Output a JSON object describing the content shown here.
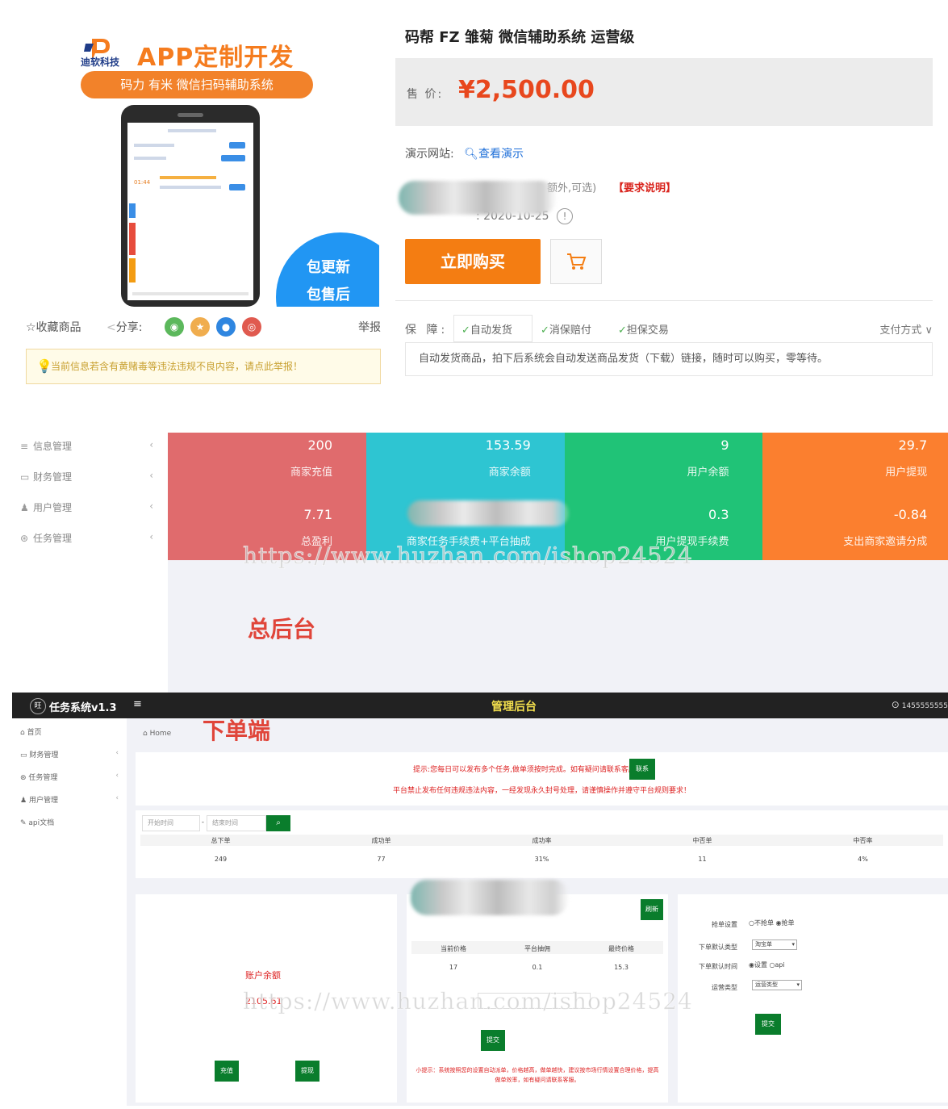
{
  "product": {
    "brand_name": "迪软科技",
    "banner_title": "APP定制开发",
    "banner_sub": "码力 有米 微信扫码辅助系统",
    "badge_line1": "包更新",
    "badge_line2": "包售后",
    "fav_label": "☆收藏商品",
    "share_label": "分享:",
    "report_label": "举报",
    "notice": "当前信息若含有黄赌毒等违法违规不良内容，请点此举报！",
    "title": "码帮 FZ 雏菊 微信辅助系统 运营级",
    "price_label": "售 价:",
    "price": "¥2,500.00",
    "demo_label": "演示网站:",
    "demo_link": "查看演示",
    "opt_note": "额外,可选)",
    "opt_req": "【要求说明】",
    "date_partial": ": 2020-10-25",
    "buy_label": "立即购买",
    "guarantee_label": "保 障:",
    "guarantees": [
      "自动发货",
      "消保赔付",
      "担保交易"
    ],
    "pay_method": "支付方式",
    "description": "自动发货商品，拍下后系统会自动发送商品发货（下载）链接，随时可以购买，零等待。",
    "phone_time": "01:44"
  },
  "admin": {
    "sidebar": [
      "信息管理",
      "财务管理",
      "用户管理",
      "任务管理"
    ],
    "stats": [
      {
        "v1": "200",
        "l1": "商家充值",
        "v2": "7.71",
        "l2": "总盈利",
        "color": "#e06b6d"
      },
      {
        "v1": "153.59",
        "l1": "商家余额",
        "v2": "",
        "l2": "商家任务手续费+平台抽成",
        "color": "#2ec5d2"
      },
      {
        "v1": "9",
        "l1": "用户余额",
        "v2": "0.3",
        "l2": "用户提现手续费",
        "color": "#20c377"
      },
      {
        "v1": "29.7",
        "l1": "用户提现",
        "v2": "-0.84",
        "l2": "支出商家邀请分成",
        "color": "#fb7f2f"
      }
    ],
    "label": "总后台",
    "watermark": "https://www.huzhan.com/ishop24524"
  },
  "client": {
    "app_name": "任务系统v1.3",
    "menu_icon": "≡",
    "center_title": "管理后台",
    "user": "1455555555",
    "label": "下单端",
    "sidebar": [
      "首页",
      "财务管理",
      "任务管理",
      "用户管理",
      "api文档"
    ],
    "breadcrumb": "Home",
    "notice_line1": "提示:您每日可以发布多个任务,做单须按时完成。如有疑问请联系客服:",
    "notice_btn": "联系",
    "notice_line2": "平台禁止发布任何违规违法内容，一经发现永久封号处理，请谨慎操作并遵守平台规则要求！",
    "date_start": "开始时间",
    "date_end": "结束时间",
    "search_icon": "search-icon",
    "stats_headers": [
      "总下单",
      "成功单",
      "成功率",
      "中否单",
      "中否率"
    ],
    "stats_values": [
      "249",
      "77",
      "31%",
      "11",
      "4%"
    ],
    "account_label": "账户余额",
    "account_value": "2105.61",
    "recharge_btn": "充值",
    "withdraw_btn": "提现",
    "refresh_btn": "刷新",
    "price_headers": [
      "当前价格",
      "平台抽佣",
      "最终价格"
    ],
    "price_values": [
      "17",
      "0.1",
      "15.3"
    ],
    "submit_btn": "提交",
    "mid_tip": "小提示：系统按照您的设置自动派单，价格越高，做单越快，建议按市场行情设置合理价格，提高做单效率，如有疑问请联系客服。",
    "form": {
      "label1": "抢单设置",
      "val1a": "不抢单",
      "val1b": "抢单",
      "label2": "下单默认类型",
      "val2": "淘宝单",
      "label3": "下单默认时间",
      "val3a": "设置",
      "val3b": "api",
      "label4": "运营类型",
      "val4": "运营类型",
      "submit": "提交"
    },
    "watermark": "https://www.huzhan.com/ishop24524"
  },
  "colors": {
    "orange": "#f47d12",
    "price_red": "#e8471d",
    "green_btn": "#0a7d2c",
    "topbar": "#222222"
  }
}
